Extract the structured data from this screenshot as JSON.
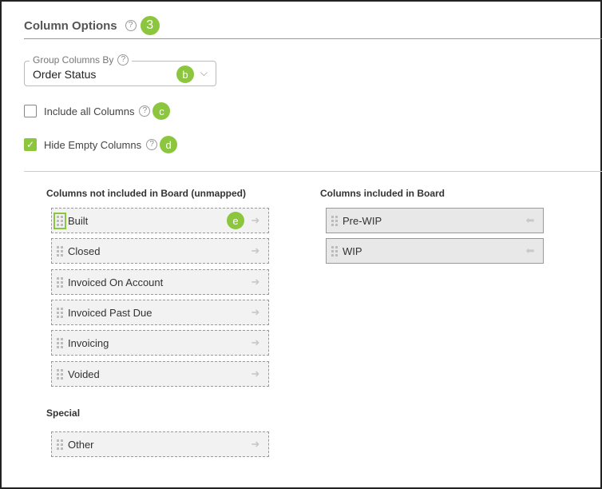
{
  "header": {
    "title": "Column Options",
    "help_icon": "?",
    "step_badge": "3"
  },
  "group_by": {
    "label": "Group Columns By",
    "help_icon": "?",
    "value": "Order Status",
    "badge": "b",
    "chevron": "⌵"
  },
  "include_all": {
    "label": "Include all Columns",
    "checked": false,
    "help_icon": "?",
    "badge": "c"
  },
  "hide_empty": {
    "label": "Hide Empty Columns",
    "checked": true,
    "check_mark": "✓",
    "help_icon": "?",
    "badge": "d"
  },
  "unmapped": {
    "title": "Columns not included in Board (unmapped)",
    "items": [
      {
        "label": "Built",
        "badge": "e"
      },
      {
        "label": "Closed"
      },
      {
        "label": "Invoiced On Account"
      },
      {
        "label": "Invoiced Past Due"
      },
      {
        "label": "Invoicing"
      },
      {
        "label": "Voided"
      }
    ]
  },
  "special": {
    "title": "Special",
    "items": [
      {
        "label": "Other"
      }
    ]
  },
  "included": {
    "title": "Columns included in Board",
    "items": [
      {
        "label": "Pre-WIP"
      },
      {
        "label": "WIP"
      }
    ]
  },
  "icons": {
    "right_arrow": "➜",
    "left_arrow": "⬅"
  },
  "colors": {
    "accent": "#8cc63f",
    "border": "#999999",
    "item_bg": "#f2f2f2"
  }
}
